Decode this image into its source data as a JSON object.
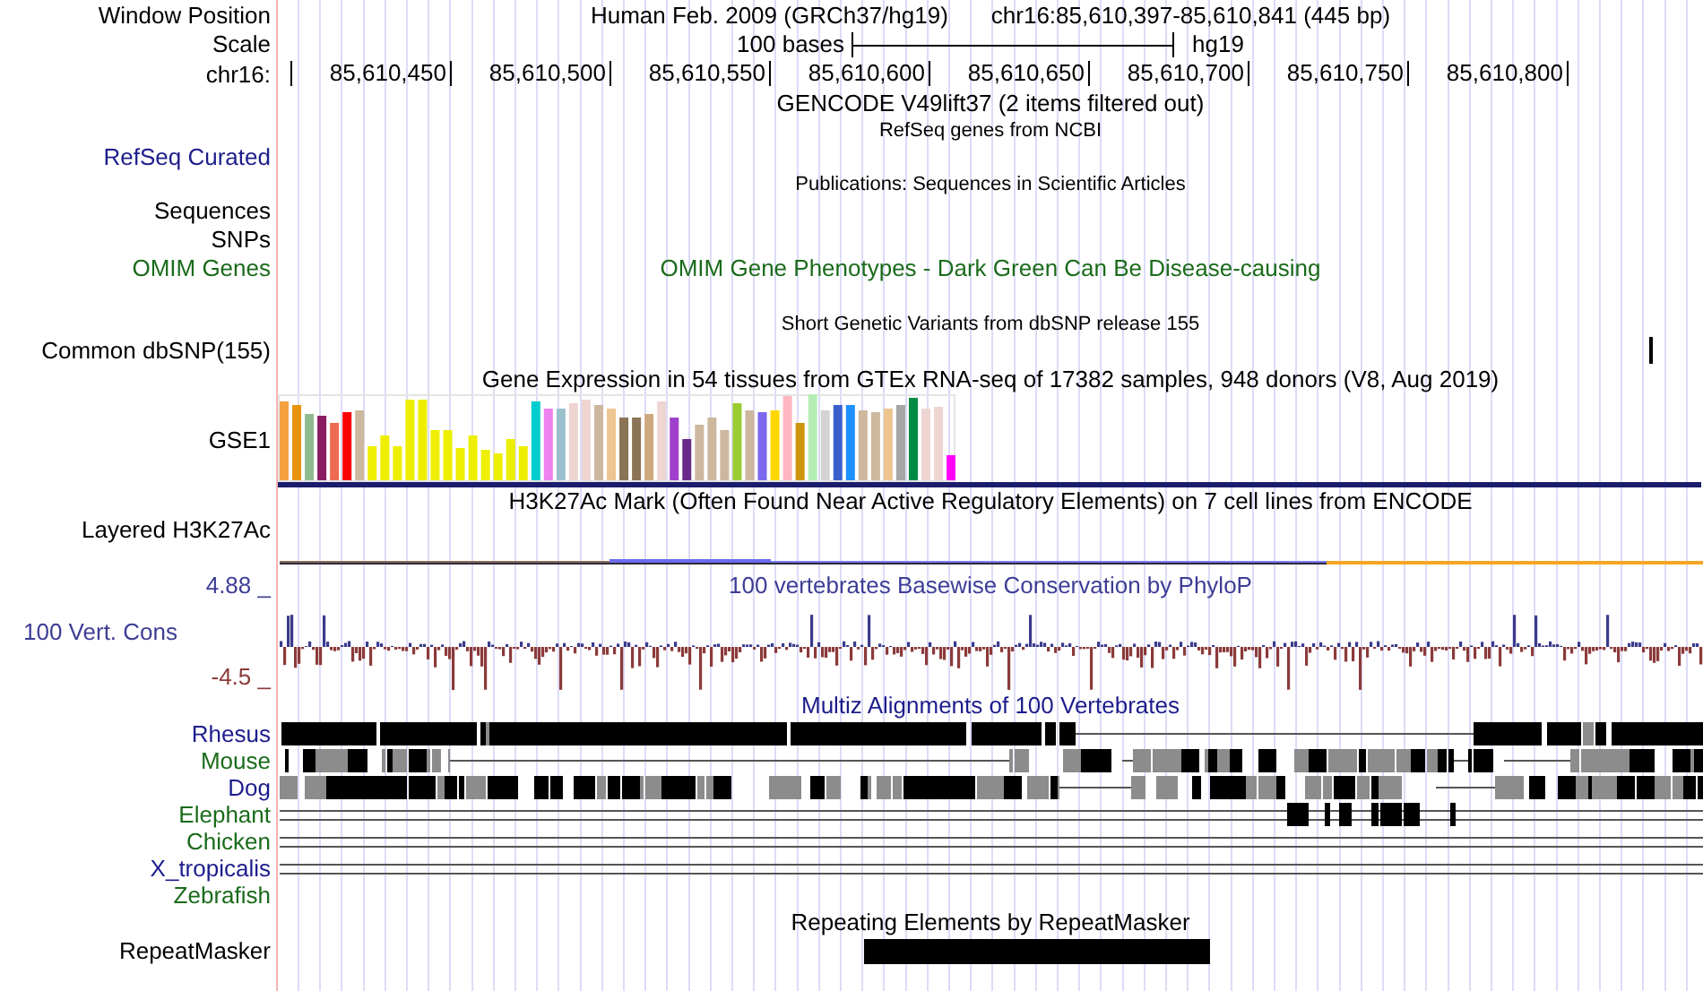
{
  "position": {
    "label": "Window Position",
    "assembly": "Human Feb. 2009 (GRCh37/hg19)",
    "range": "chr16:85,610,397-85,610,841 (445 bp)"
  },
  "scale": {
    "label": "Scale",
    "length": "100 bases",
    "assembly": "hg19"
  },
  "ruler": {
    "label": "chr16:",
    "ticks": [
      "85,610,450",
      "85,610,500",
      "85,610,550",
      "85,610,600",
      "85,610,650",
      "85,610,700",
      "85,610,750",
      "85,610,800"
    ]
  },
  "tracks": [
    {
      "kind": "title",
      "title": "GENCODE V49lift37 (2 items filtered out)"
    },
    {
      "kind": "note",
      "title": "RefSeq genes from NCBI"
    },
    {
      "kind": "label",
      "label": "RefSeq Curated",
      "color": "#1c1c8c"
    },
    {
      "kind": "note",
      "title": "Publications: Sequences in Scientific Articles"
    },
    {
      "kind": "label",
      "label": "Sequences"
    },
    {
      "kind": "label",
      "label": "SNPs"
    },
    {
      "kind": "title",
      "label": "OMIM Genes",
      "title": "OMIM Gene Phenotypes - Dark Green Can Be Disease-causing",
      "color": "#1a6b1a"
    },
    {
      "kind": "note",
      "title": "Short Genetic Variants from dbSNP release 155"
    },
    {
      "kind": "snp",
      "label": "Common dbSNP(155)"
    },
    {
      "kind": "title",
      "title": "Gene Expression in 54 tissues from GTEx RNA-seq of 17382 samples, 948 donors (V8, Aug 2019)"
    },
    {
      "kind": "expression",
      "label": "GSE1"
    },
    {
      "kind": "title",
      "title": "H3K27Ac Mark (Often Found Near Active Regulatory Elements) on 7 cell lines from ENCODE"
    },
    {
      "kind": "layered",
      "label": "Layered H3K27Ac"
    },
    {
      "kind": "conservation",
      "label": "100 Vert. Cons",
      "title": "100 vertebrates Basewise Conservation by PhyloP",
      "max": "4.88 _",
      "min": "-4.5 _",
      "color": "#3d3d96"
    },
    {
      "kind": "title",
      "title": "Multiz Alignments of 100 Vertebrates",
      "color": "#1c1c8c"
    },
    {
      "kind": "alignment",
      "label": "Rhesus",
      "color": "#1c1c8c"
    },
    {
      "kind": "alignment",
      "label": "Mouse",
      "color": "#1a6b1a"
    },
    {
      "kind": "alignment",
      "label": "Dog",
      "color": "#1c1c8c"
    },
    {
      "kind": "alignment",
      "label": "Elephant",
      "color": "#1a6b1a"
    },
    {
      "kind": "alignment",
      "label": "Chicken",
      "color": "#1a6b1a"
    },
    {
      "kind": "alignment",
      "label": "X_tropicalis",
      "color": "#1c1c8c"
    },
    {
      "kind": "alignment",
      "label": "Zebrafish",
      "color": "#1a6b1a"
    },
    {
      "kind": "title",
      "title": "Repeating Elements by RepeatMasker"
    },
    {
      "kind": "repeat",
      "label": "RepeatMasker"
    }
  ]
}
